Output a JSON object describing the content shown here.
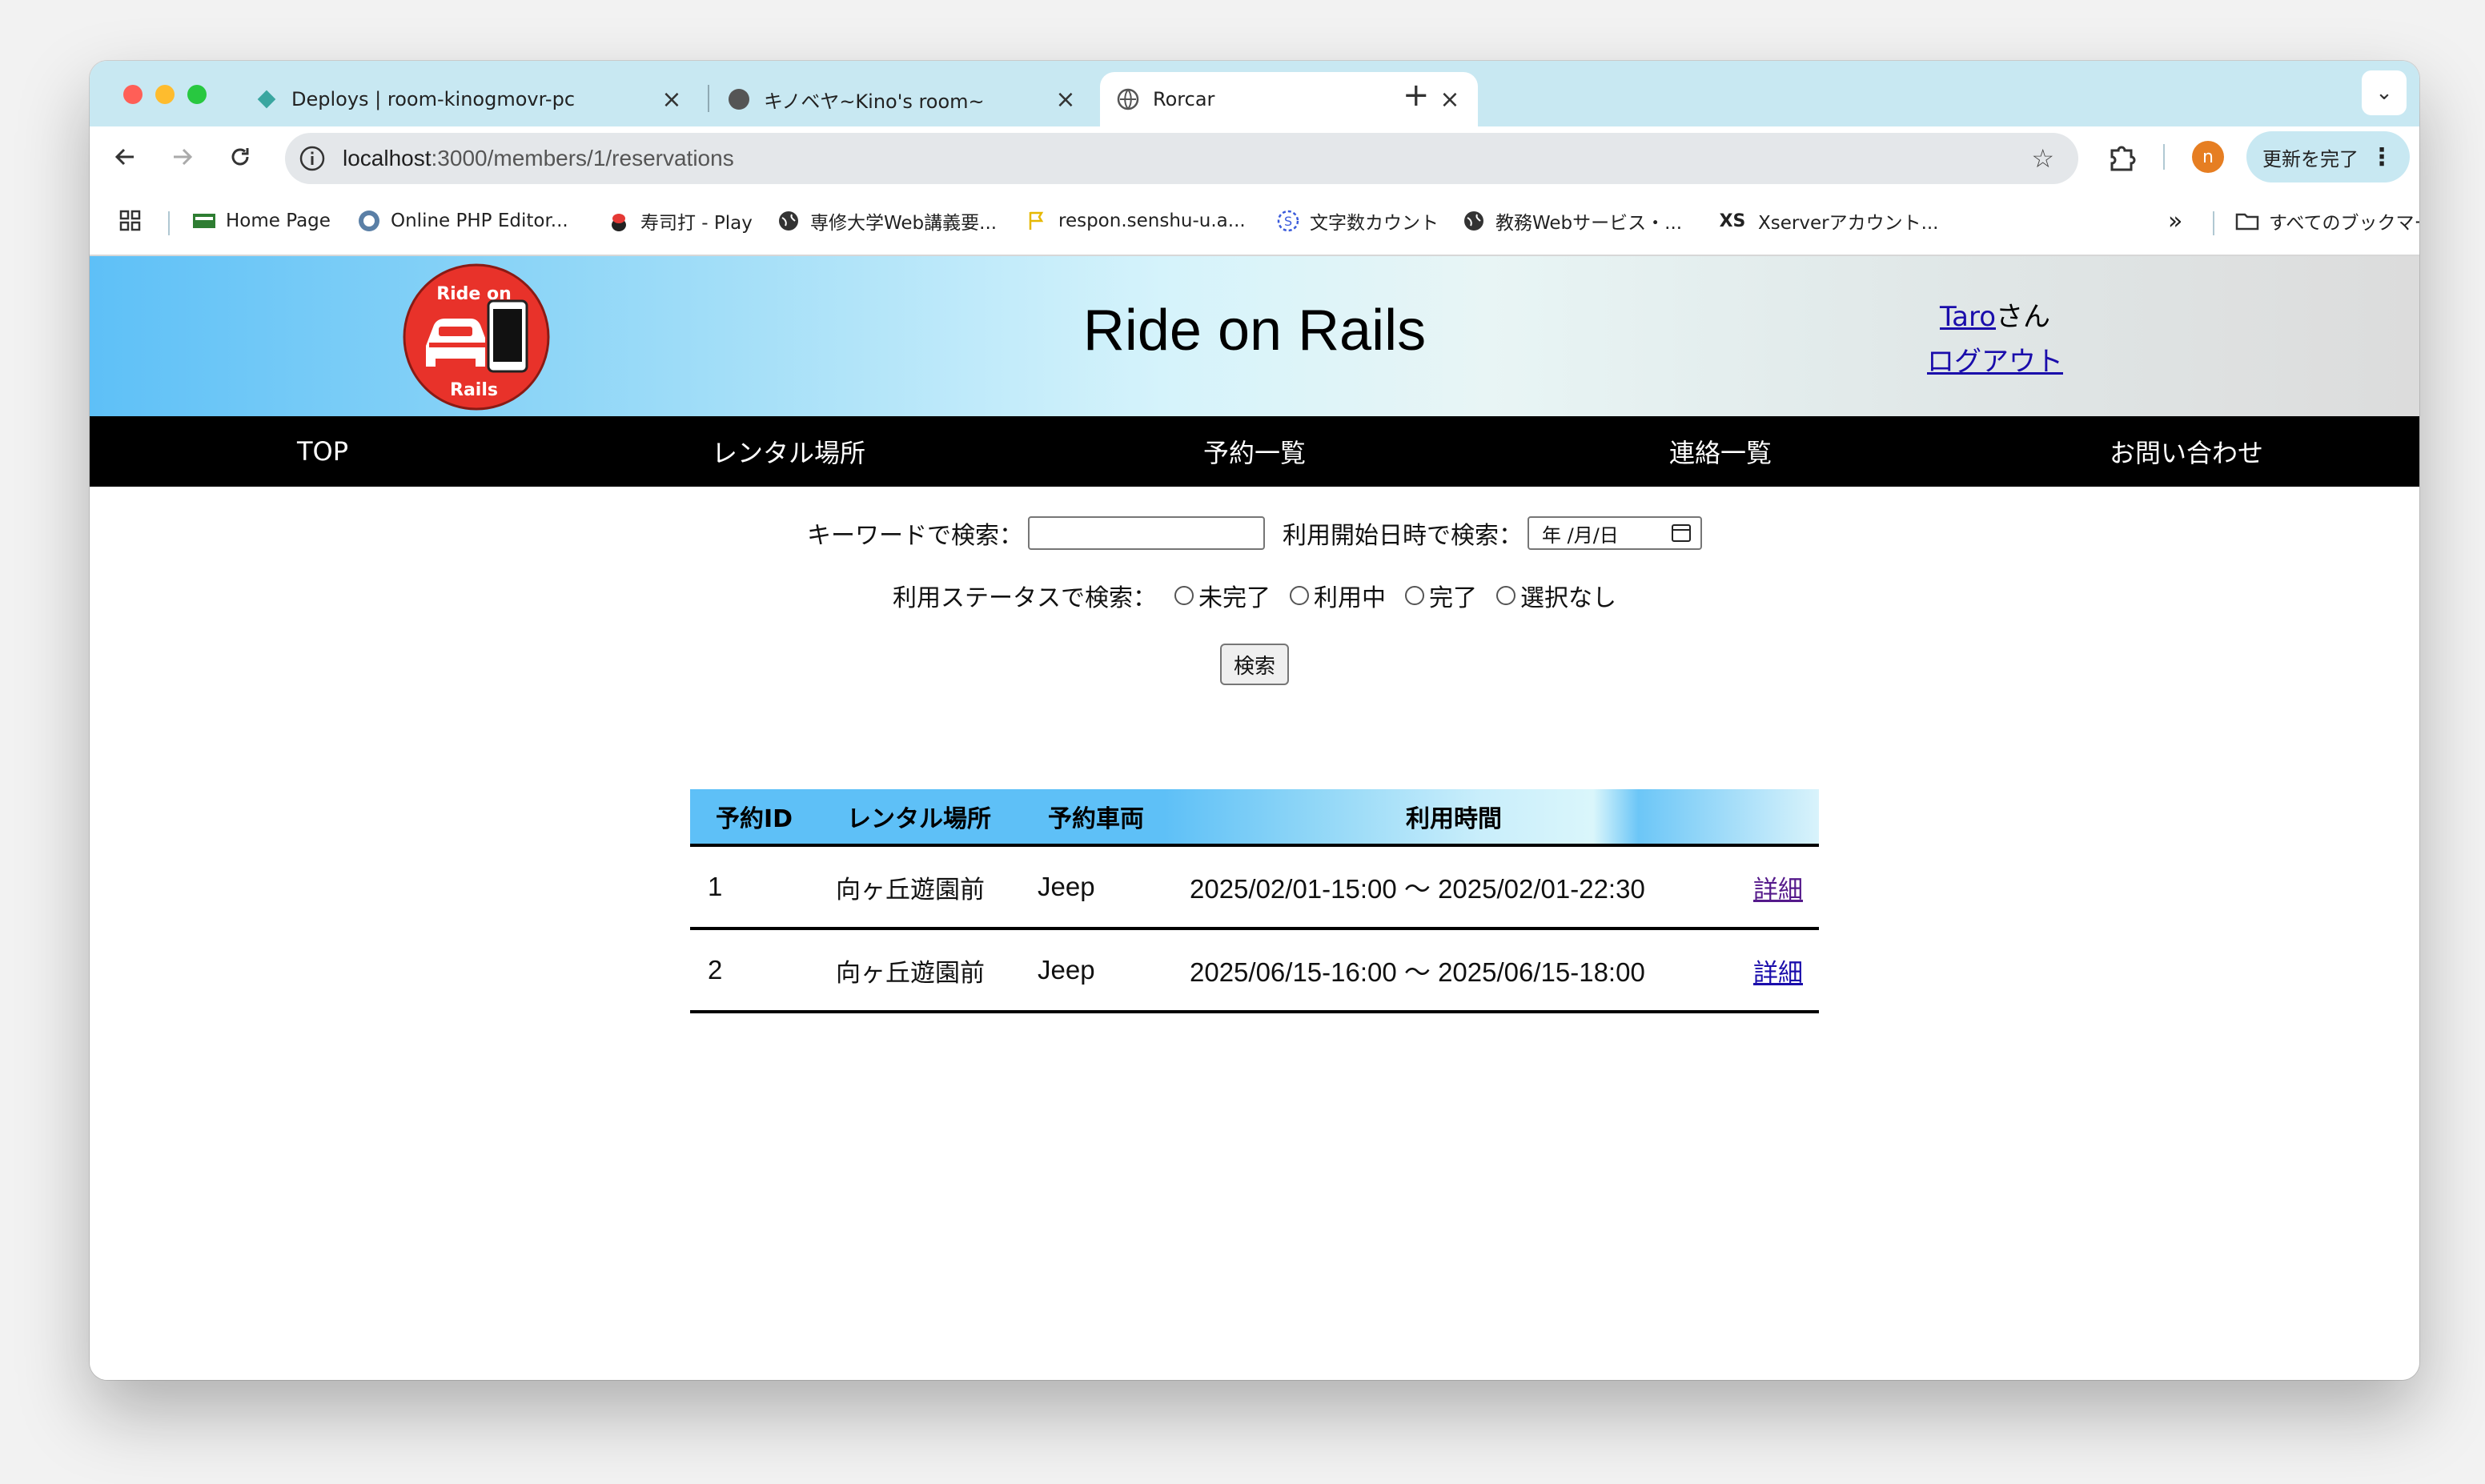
{
  "browser": {
    "tabs": [
      {
        "title": "Deploys | room-kinogmovr-pc",
        "icon": "diamond-icon",
        "active": false
      },
      {
        "title": "キノベヤ~Kino's room~",
        "icon": "circle-icon",
        "active": false
      },
      {
        "title": "Rorcar",
        "icon": "globe-icon",
        "active": true
      }
    ],
    "url_host": "localhost",
    "url_path": ":3000/members/1/reservations",
    "profile_initial": "n",
    "update_label": "更新を完了",
    "bookmarks": [
      {
        "label": "Home Page",
        "icon": "xampp-icon"
      },
      {
        "label": "Online PHP Editor...",
        "icon": "php-icon"
      },
      {
        "label": "寿司打 - Play",
        "icon": "sushi-icon"
      },
      {
        "label": "専修大学Web講義要...",
        "icon": "globe-icon"
      },
      {
        "label": "respon.senshu-u.a...",
        "icon": "flag-icon"
      },
      {
        "label": "文字数カウント",
        "icon": "s-logo-icon"
      },
      {
        "label": "教務Webサービス・...",
        "icon": "globe-icon"
      },
      {
        "label": "Xserverアカウント...",
        "icon": "xs-icon"
      }
    ],
    "all_bookmarks_label": "すべてのブックマーク"
  },
  "site": {
    "title": "Ride on Rails",
    "logo_text_top": "Ride on",
    "logo_text_bottom": "Rails",
    "user_name": "Taro",
    "user_suffix": "さん",
    "logout_label": "ログアウト",
    "nav": [
      "TOP",
      "レンタル場所",
      "予約一覧",
      "連絡一覧",
      "お問い合わせ"
    ]
  },
  "search": {
    "keyword_label": "キーワードで検索：",
    "keyword_value": "",
    "date_label": "利用開始日時で検索：",
    "date_placeholder": "年 /月/日",
    "status_label": "利用ステータスで検索：",
    "status_options": [
      "未完了",
      "利用中",
      "完了",
      "選択なし"
    ],
    "submit_label": "検索"
  },
  "table": {
    "headers": [
      "予約ID",
      "レンタル場所",
      "予約車両",
      "利用時間",
      ""
    ],
    "rows": [
      {
        "id": "1",
        "place": "向ヶ丘遊園前",
        "car": "Jeep",
        "time": "2025/02/01-15:00 〜 2025/02/01-22:30",
        "link": "詳細"
      },
      {
        "id": "2",
        "place": "向ヶ丘遊園前",
        "car": "Jeep",
        "time": "2025/06/15-16:00 〜 2025/06/15-18:00",
        "link": "詳細"
      }
    ]
  },
  "colors": {
    "header_blue": "#5ec0f7",
    "nav_bg": "#000000",
    "link": "#1a0dab",
    "visited_link": "#551a8b",
    "logo_red": "#e8322a"
  }
}
